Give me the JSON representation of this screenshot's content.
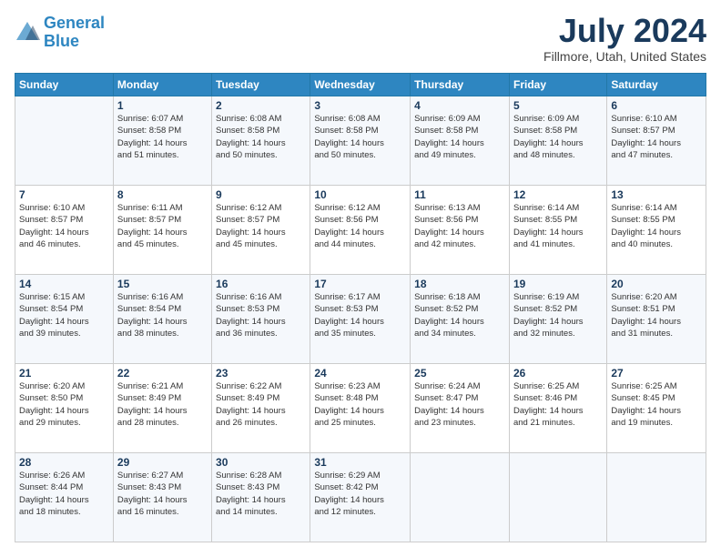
{
  "logo": {
    "line1": "General",
    "line2": "Blue"
  },
  "title": "July 2024",
  "subtitle": "Fillmore, Utah, United States",
  "days_header": [
    "Sunday",
    "Monday",
    "Tuesday",
    "Wednesday",
    "Thursday",
    "Friday",
    "Saturday"
  ],
  "weeks": [
    [
      {
        "num": "",
        "detail": ""
      },
      {
        "num": "1",
        "detail": "Sunrise: 6:07 AM\nSunset: 8:58 PM\nDaylight: 14 hours\nand 51 minutes."
      },
      {
        "num": "2",
        "detail": "Sunrise: 6:08 AM\nSunset: 8:58 PM\nDaylight: 14 hours\nand 50 minutes."
      },
      {
        "num": "3",
        "detail": "Sunrise: 6:08 AM\nSunset: 8:58 PM\nDaylight: 14 hours\nand 50 minutes."
      },
      {
        "num": "4",
        "detail": "Sunrise: 6:09 AM\nSunset: 8:58 PM\nDaylight: 14 hours\nand 49 minutes."
      },
      {
        "num": "5",
        "detail": "Sunrise: 6:09 AM\nSunset: 8:58 PM\nDaylight: 14 hours\nand 48 minutes."
      },
      {
        "num": "6",
        "detail": "Sunrise: 6:10 AM\nSunset: 8:57 PM\nDaylight: 14 hours\nand 47 minutes."
      }
    ],
    [
      {
        "num": "7",
        "detail": "Sunrise: 6:10 AM\nSunset: 8:57 PM\nDaylight: 14 hours\nand 46 minutes."
      },
      {
        "num": "8",
        "detail": "Sunrise: 6:11 AM\nSunset: 8:57 PM\nDaylight: 14 hours\nand 45 minutes."
      },
      {
        "num": "9",
        "detail": "Sunrise: 6:12 AM\nSunset: 8:57 PM\nDaylight: 14 hours\nand 45 minutes."
      },
      {
        "num": "10",
        "detail": "Sunrise: 6:12 AM\nSunset: 8:56 PM\nDaylight: 14 hours\nand 44 minutes."
      },
      {
        "num": "11",
        "detail": "Sunrise: 6:13 AM\nSunset: 8:56 PM\nDaylight: 14 hours\nand 42 minutes."
      },
      {
        "num": "12",
        "detail": "Sunrise: 6:14 AM\nSunset: 8:55 PM\nDaylight: 14 hours\nand 41 minutes."
      },
      {
        "num": "13",
        "detail": "Sunrise: 6:14 AM\nSunset: 8:55 PM\nDaylight: 14 hours\nand 40 minutes."
      }
    ],
    [
      {
        "num": "14",
        "detail": "Sunrise: 6:15 AM\nSunset: 8:54 PM\nDaylight: 14 hours\nand 39 minutes."
      },
      {
        "num": "15",
        "detail": "Sunrise: 6:16 AM\nSunset: 8:54 PM\nDaylight: 14 hours\nand 38 minutes."
      },
      {
        "num": "16",
        "detail": "Sunrise: 6:16 AM\nSunset: 8:53 PM\nDaylight: 14 hours\nand 36 minutes."
      },
      {
        "num": "17",
        "detail": "Sunrise: 6:17 AM\nSunset: 8:53 PM\nDaylight: 14 hours\nand 35 minutes."
      },
      {
        "num": "18",
        "detail": "Sunrise: 6:18 AM\nSunset: 8:52 PM\nDaylight: 14 hours\nand 34 minutes."
      },
      {
        "num": "19",
        "detail": "Sunrise: 6:19 AM\nSunset: 8:52 PM\nDaylight: 14 hours\nand 32 minutes."
      },
      {
        "num": "20",
        "detail": "Sunrise: 6:20 AM\nSunset: 8:51 PM\nDaylight: 14 hours\nand 31 minutes."
      }
    ],
    [
      {
        "num": "21",
        "detail": "Sunrise: 6:20 AM\nSunset: 8:50 PM\nDaylight: 14 hours\nand 29 minutes."
      },
      {
        "num": "22",
        "detail": "Sunrise: 6:21 AM\nSunset: 8:49 PM\nDaylight: 14 hours\nand 28 minutes."
      },
      {
        "num": "23",
        "detail": "Sunrise: 6:22 AM\nSunset: 8:49 PM\nDaylight: 14 hours\nand 26 minutes."
      },
      {
        "num": "24",
        "detail": "Sunrise: 6:23 AM\nSunset: 8:48 PM\nDaylight: 14 hours\nand 25 minutes."
      },
      {
        "num": "25",
        "detail": "Sunrise: 6:24 AM\nSunset: 8:47 PM\nDaylight: 14 hours\nand 23 minutes."
      },
      {
        "num": "26",
        "detail": "Sunrise: 6:25 AM\nSunset: 8:46 PM\nDaylight: 14 hours\nand 21 minutes."
      },
      {
        "num": "27",
        "detail": "Sunrise: 6:25 AM\nSunset: 8:45 PM\nDaylight: 14 hours\nand 19 minutes."
      }
    ],
    [
      {
        "num": "28",
        "detail": "Sunrise: 6:26 AM\nSunset: 8:44 PM\nDaylight: 14 hours\nand 18 minutes."
      },
      {
        "num": "29",
        "detail": "Sunrise: 6:27 AM\nSunset: 8:43 PM\nDaylight: 14 hours\nand 16 minutes."
      },
      {
        "num": "30",
        "detail": "Sunrise: 6:28 AM\nSunset: 8:43 PM\nDaylight: 14 hours\nand 14 minutes."
      },
      {
        "num": "31",
        "detail": "Sunrise: 6:29 AM\nSunset: 8:42 PM\nDaylight: 14 hours\nand 12 minutes."
      },
      {
        "num": "",
        "detail": ""
      },
      {
        "num": "",
        "detail": ""
      },
      {
        "num": "",
        "detail": ""
      }
    ]
  ]
}
